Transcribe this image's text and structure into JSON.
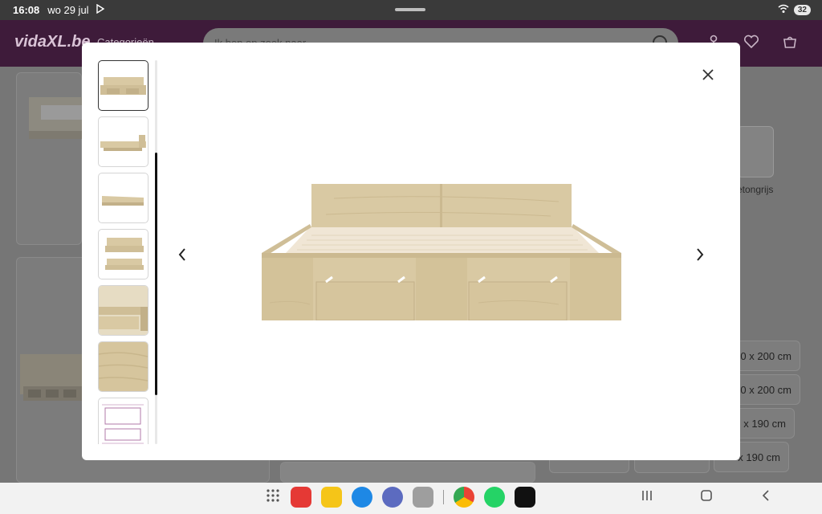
{
  "status_bar": {
    "time": "16:08",
    "date": "wo 29 jul",
    "battery": "32"
  },
  "site_header": {
    "logo": "vidaXL.be",
    "categories_label": "Categorieën",
    "search_placeholder": "Ik ben op zoek naar..."
  },
  "background_page": {
    "variant_label": "etongrijs",
    "size_options": [
      "0 x 200 cm",
      "0 x 200 cm",
      "x 190 cm",
      "x 190 cm"
    ]
  },
  "gallery_modal": {
    "thumbnail_count": 7,
    "active_thumbnail": 1,
    "close_icon": "close-icon",
    "prev_icon": "chevron-left-icon",
    "next_icon": "chevron-right-icon",
    "thumbnails": [
      {
        "name": "bed-front-view"
      },
      {
        "name": "bed-side-view"
      },
      {
        "name": "bed-angled-view"
      },
      {
        "name": "bed-two-views"
      },
      {
        "name": "drawer-detail"
      },
      {
        "name": "wood-texture"
      },
      {
        "name": "dimensions-drawing"
      }
    ]
  },
  "nav_bar": {
    "apps": [
      "apps-grid-icon",
      "flipboard-icon",
      "files-icon",
      "messages-icon",
      "browser-icon",
      "camera-icon",
      "chrome-icon",
      "whatsapp-icon",
      "netflix-icon"
    ]
  },
  "colors": {
    "wood": "#d9c9a3",
    "wood_dark": "#c2b089",
    "brand_purple": "#7a2a72"
  }
}
